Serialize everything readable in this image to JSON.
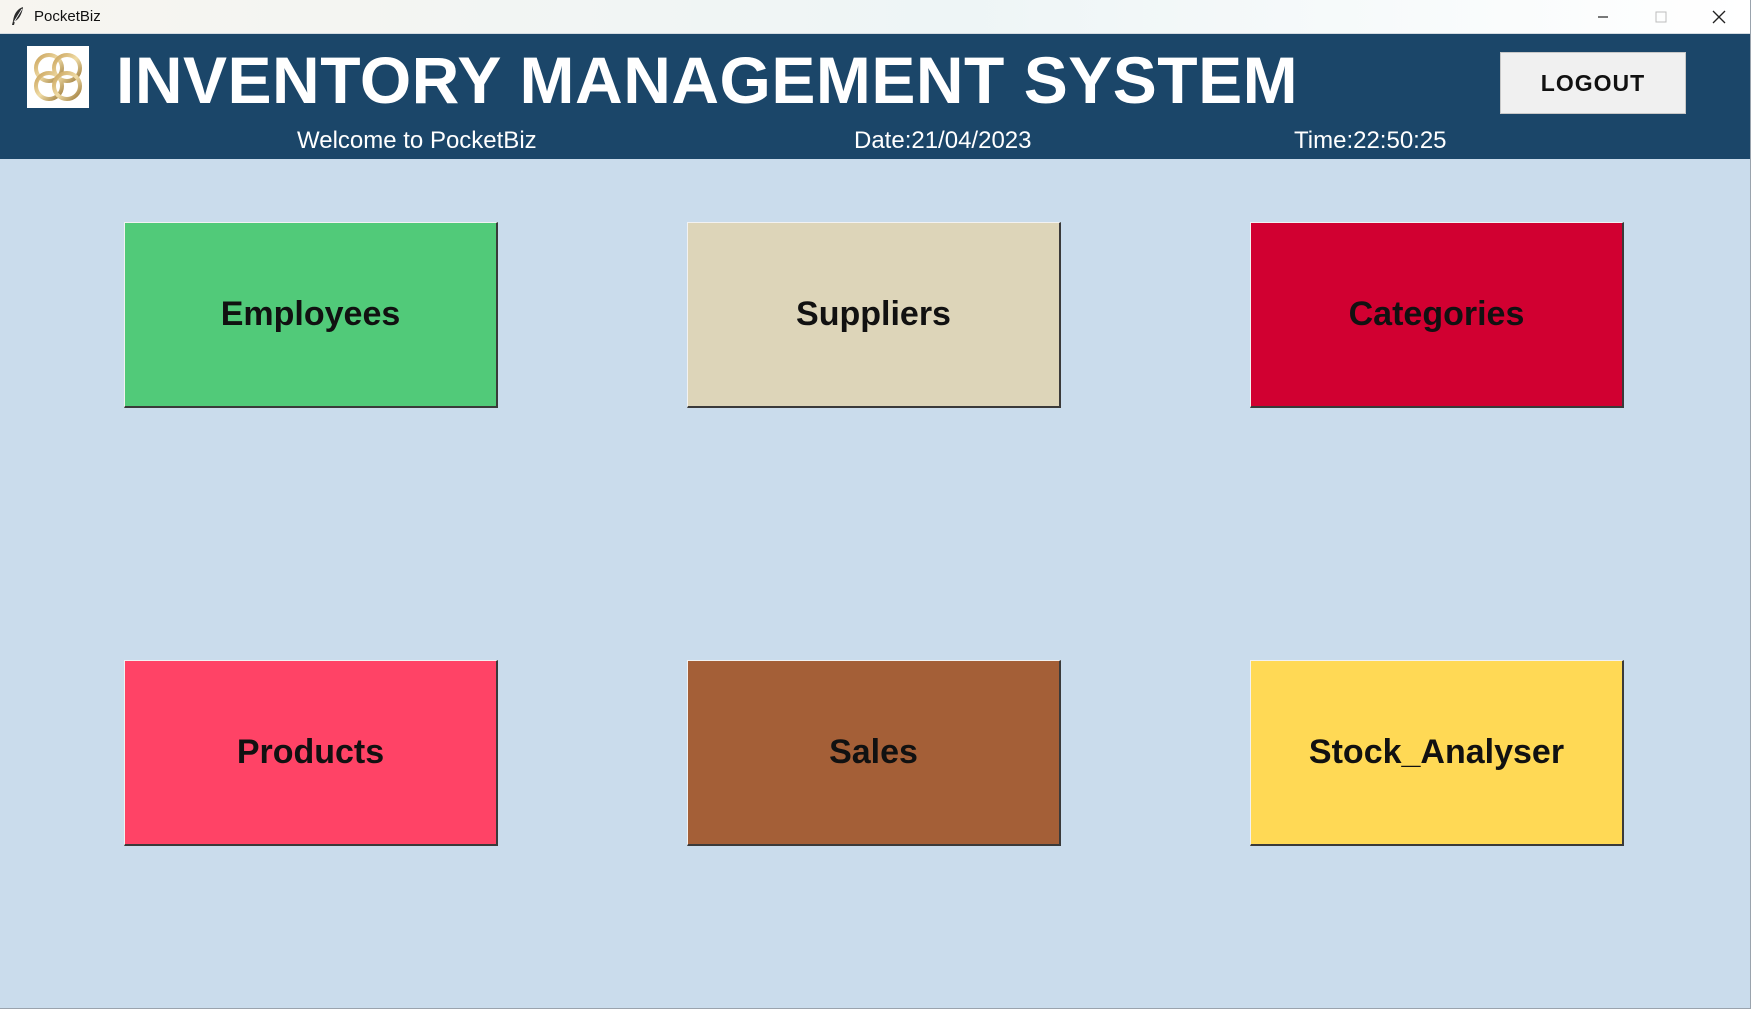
{
  "window": {
    "title": "PocketBiz",
    "icon": "feather-icon"
  },
  "header": {
    "title": "INVENTORY MANAGEMENT SYSTEM",
    "logo_icon": "logo-icon",
    "logout_label": "LOGOUT",
    "welcome": "Welcome to PocketBiz",
    "date": "Date:21/04/2023",
    "time": "Time:22:50:25"
  },
  "tiles": [
    {
      "label": "Employees",
      "color": "#51ca79"
    },
    {
      "label": "Suppliers",
      "color": "#ddd5b9"
    },
    {
      "label": "Categories",
      "color": "#d10031"
    },
    {
      "label": "Products",
      "color": "#ff4366"
    },
    {
      "label": "Sales",
      "color": "#a45f37"
    },
    {
      "label": "Stock_Analyser",
      "color": "#ffd955"
    }
  ],
  "colors": {
    "header_bg": "#1b4669",
    "body_bg": "#cadcec"
  }
}
